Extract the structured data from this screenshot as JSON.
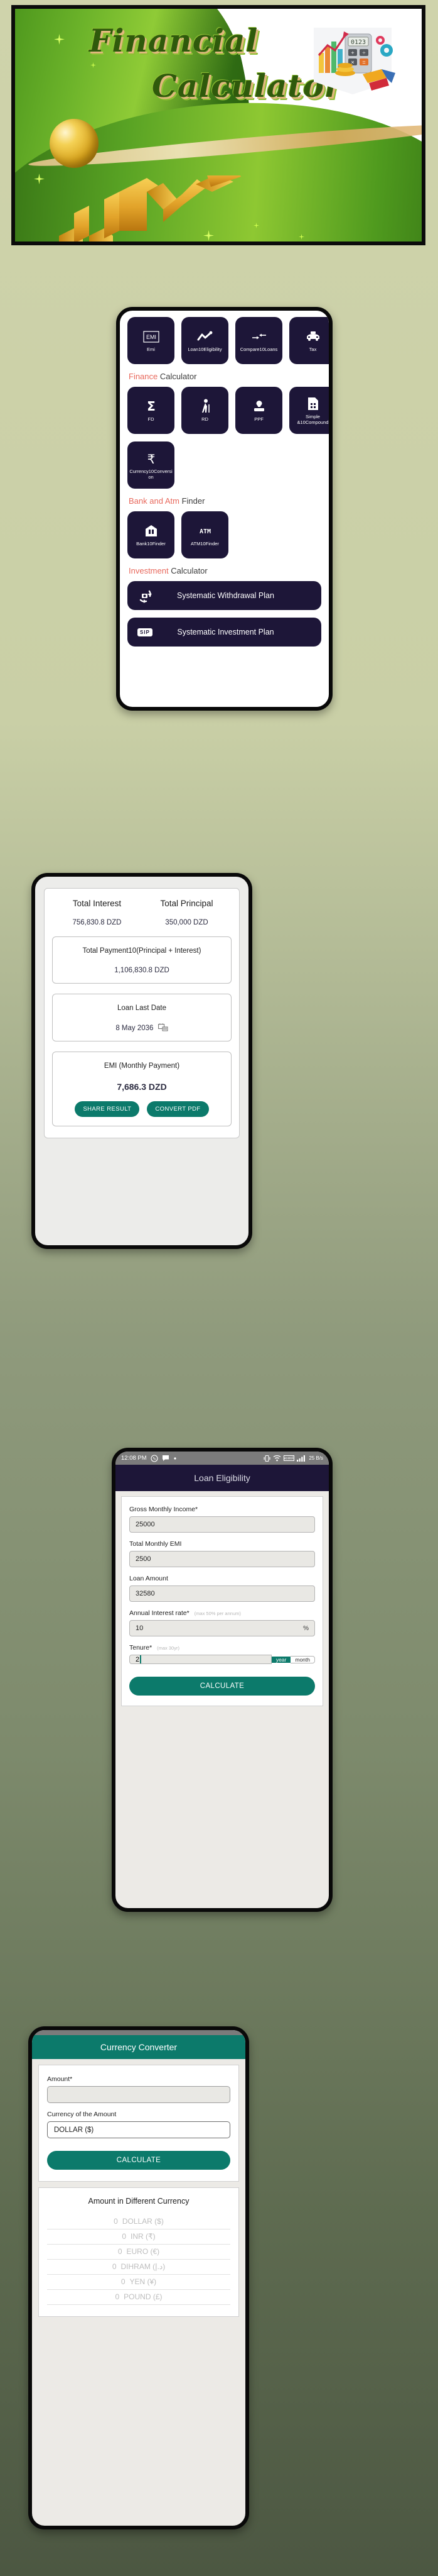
{
  "banner": {
    "title_line1": "Financial",
    "title_line2": "Calculator",
    "icon": "calculator-chart-icon"
  },
  "home": {
    "row1": [
      {
        "label": "Emi",
        "icon": "emi-box-icon"
      },
      {
        "label": "Loan10Eligibility",
        "icon": "line-chart-icon"
      },
      {
        "label": "Compare10Loans",
        "icon": "compare-arrows-icon"
      },
      {
        "label": "Tax",
        "icon": "taxi-icon"
      }
    ],
    "section_finance": {
      "accent": "Finance",
      "rest": "Calculator"
    },
    "row2": [
      {
        "label": "FD",
        "icon": "sigma-icon"
      },
      {
        "label": "RD",
        "icon": "elderly-walking-icon"
      },
      {
        "label": "PPF",
        "icon": "stamp-icon"
      },
      {
        "label": "Simple &10Compound",
        "icon": "sim-card-icon"
      }
    ],
    "row3": [
      {
        "label": "Currency10Conversion",
        "icon": "rupee-icon"
      }
    ],
    "section_bank": {
      "accent": "Bank and Atm",
      "rest": "Finder"
    },
    "row4": [
      {
        "label": "Bank10Finder",
        "icon": "bank-building-icon"
      },
      {
        "label": "ATM10Finder",
        "icon": "atm-text-icon"
      }
    ],
    "section_investment": {
      "accent": "Investment",
      "rest": "Calculator"
    },
    "wide": [
      {
        "label": "Systematic Withdrawal Plan",
        "icon": "swp-rotate-icon"
      },
      {
        "label": "Systematic Investment Plan",
        "icon": "sip-badge-icon"
      }
    ]
  },
  "emi_result": {
    "total_interest_label": "Total Interest",
    "total_principal_label": "Total Principal",
    "total_interest_value": "756,830.8 DZD",
    "total_principal_value": "350,000 DZD",
    "total_payment_label": "Total Payment10(Principal + Interest)",
    "total_payment_value": "1,106,830.8 DZD",
    "loan_last_date_label": "Loan Last Date",
    "loan_last_date_value": "8 May 2036",
    "calendar_icon": "calendar-money-icon",
    "emi_label": "EMI (Monthly Payment)",
    "emi_value": "7,686.3 DZD",
    "share_button": "SHARE RESULT",
    "pdf_button": "CONVERT PDF"
  },
  "loan_eligibility": {
    "status_time": "12:08 PM",
    "status_icons": [
      "whatsapp-icon",
      "chat-bubble-icon",
      "dot-icon"
    ],
    "status_right_icons": [
      "vibrate-icon",
      "wifi-icon",
      "vowifi-icon",
      "signal-bars-icon"
    ],
    "status_rate": "25 B/s",
    "title": "Loan Eligibility",
    "fields": [
      {
        "label": "Gross Monthly Income*",
        "hint": "",
        "value": "25000",
        "suffix": ""
      },
      {
        "label": "Total Monthly EMI",
        "hint": "",
        "value": "2500",
        "suffix": ""
      },
      {
        "label": "Loan Amount",
        "hint": "",
        "value": "32580",
        "suffix": ""
      },
      {
        "label": "Annual Interest rate*",
        "hint": "(max 50% per annum)",
        "value": "10",
        "suffix": "%"
      }
    ],
    "tenure_label": "Tenure*",
    "tenure_hint": "(max 30yr)",
    "tenure_value": "2",
    "tenure_unit_selected": "year",
    "tenure_unit_other": "month",
    "calculate_button": "CALCULATE"
  },
  "currency_converter": {
    "title": "Currency Converter",
    "amount_label": "Amount*",
    "amount_value": "",
    "currency_label": "Currency of the Amount",
    "currency_value": "DOLLAR ($)",
    "calculate_button": "CALCULATE",
    "results_title": "Amount in Different Currency",
    "results": [
      {
        "value": "0",
        "name": "DOLLAR ($)"
      },
      {
        "value": "0",
        "name": "INR (₹)"
      },
      {
        "value": "0",
        "name": "EURO (€)"
      },
      {
        "value": "0",
        "name": "DIHRAM (د.إ)"
      },
      {
        "value": "0",
        "name": "YEN (¥)"
      },
      {
        "value": "0",
        "name": "POUND (£)"
      }
    ]
  },
  "colors": {
    "dark_navy": "#1d1638",
    "teal": "#0c7a6b",
    "accent_red": "#e8695d",
    "banner_green": "#2f5a0c"
  }
}
